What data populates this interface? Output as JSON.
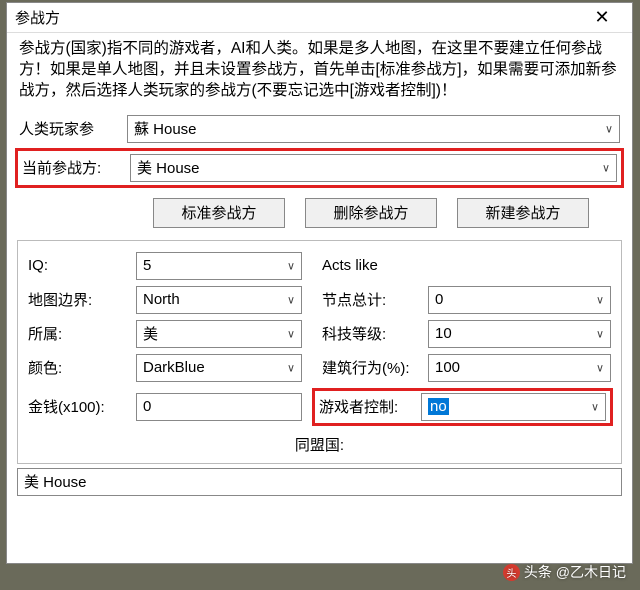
{
  "title": "参战方",
  "instructions": "参战方(国家)指不同的游戏者，AI和人类。如果是多人地图，在这里不要建立任何参战方！如果是单人地图，并且未设置参战方，首先单击[标准参战方]，如果需要可添加新参战方，然后选择人类玩家的参战方(不要忘记选中[游戏者控制])！",
  "rows": {
    "human_player_label": "人类玩家参",
    "human_player_value": "蘇 House",
    "current_side_label": "当前参战方:",
    "current_side_value": "美 House"
  },
  "buttons": {
    "standard": "标准参战方",
    "delete": "删除参战方",
    "new": "新建参战方"
  },
  "form": {
    "iq_label": "IQ:",
    "iq_value": "5",
    "acts_like_label": "Acts like",
    "map_edge_label": "地图边界:",
    "map_edge_value": "North",
    "nodes_label": "节点总计:",
    "nodes_value": "0",
    "side_label": "所属:",
    "side_value": "美",
    "tech_label": "科技等级:",
    "tech_value": "10",
    "color_label": "颜色:",
    "color_value": "DarkBlue",
    "build_label": "建筑行为(%):",
    "build_value": "100",
    "money_label": "金钱(x100):",
    "money_value": "0",
    "player_ctrl_label": "游戏者控制:",
    "player_ctrl_value": "no",
    "allies_label": "同盟国:"
  },
  "bottom_value": "美 House",
  "watermark": "头条 @乙木日记"
}
